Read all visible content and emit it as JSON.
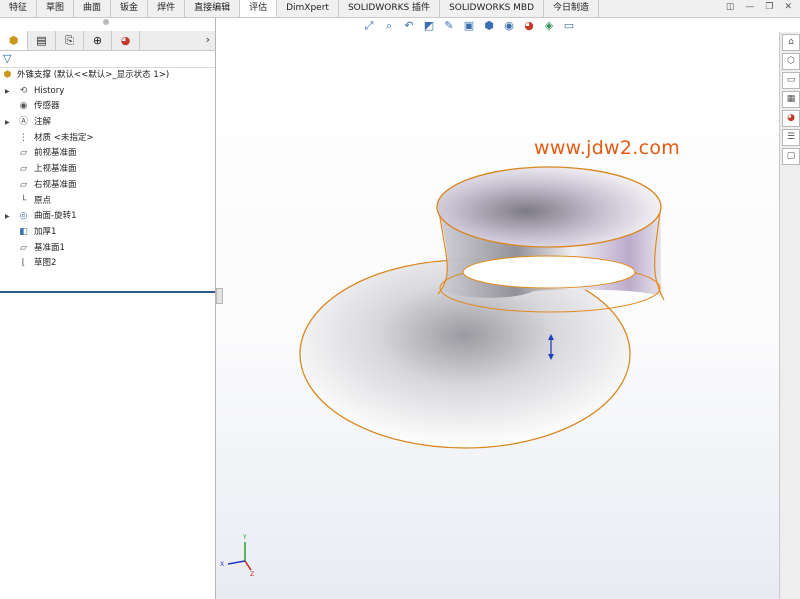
{
  "tabs": [
    {
      "label": "特征",
      "active": false
    },
    {
      "label": "草图",
      "active": false
    },
    {
      "label": "曲面",
      "active": false
    },
    {
      "label": "钣金",
      "active": false
    },
    {
      "label": "焊件",
      "active": false
    },
    {
      "label": "直接编辑",
      "active": false
    },
    {
      "label": "评估",
      "active": true
    },
    {
      "label": "DimXpert",
      "active": false
    },
    {
      "label": "SOLIDWORKS 插件",
      "active": false
    },
    {
      "label": "SOLIDWORKS MBD",
      "active": false
    },
    {
      "label": "今日制造",
      "active": false
    }
  ],
  "feature_manager": {
    "tab_icons": [
      "feature-tree-icon",
      "property-manager-icon",
      "configuration-manager-icon",
      "dimxpert-icon",
      "display-manager-icon"
    ],
    "root": "外锥支撑 (默认<<默认>_显示状态 1>)",
    "items": [
      {
        "label": "History",
        "icon": "history-icon",
        "expandable": true
      },
      {
        "label": "传感器",
        "icon": "sensor-icon",
        "expandable": false
      },
      {
        "label": "注解",
        "icon": "annotation-icon",
        "expandable": true
      },
      {
        "label": "材质 <未指定>",
        "icon": "material-icon",
        "expandable": false
      },
      {
        "label": "前视基准面",
        "icon": "plane-icon",
        "expandable": false
      },
      {
        "label": "上视基准面",
        "icon": "plane-icon",
        "expandable": false
      },
      {
        "label": "右视基准面",
        "icon": "plane-icon",
        "expandable": false
      },
      {
        "label": "原点",
        "icon": "origin-icon",
        "expandable": false
      },
      {
        "label": "曲面-旋转1",
        "icon": "revolve-surface-icon",
        "expandable": true
      },
      {
        "label": "加厚1",
        "icon": "thicken-icon",
        "expandable": false
      },
      {
        "label": "基准面1",
        "icon": "plane-icon",
        "expandable": false
      },
      {
        "label": "草图2",
        "icon": "sketch-icon",
        "expandable": false
      }
    ]
  },
  "watermark": "www.jdw2.com",
  "triad": {
    "x": "X",
    "y": "Y",
    "z": "Z"
  },
  "colors": {
    "accent": "#2f5a8e",
    "edge": "#e3891f",
    "watermark": "#e55a12"
  }
}
